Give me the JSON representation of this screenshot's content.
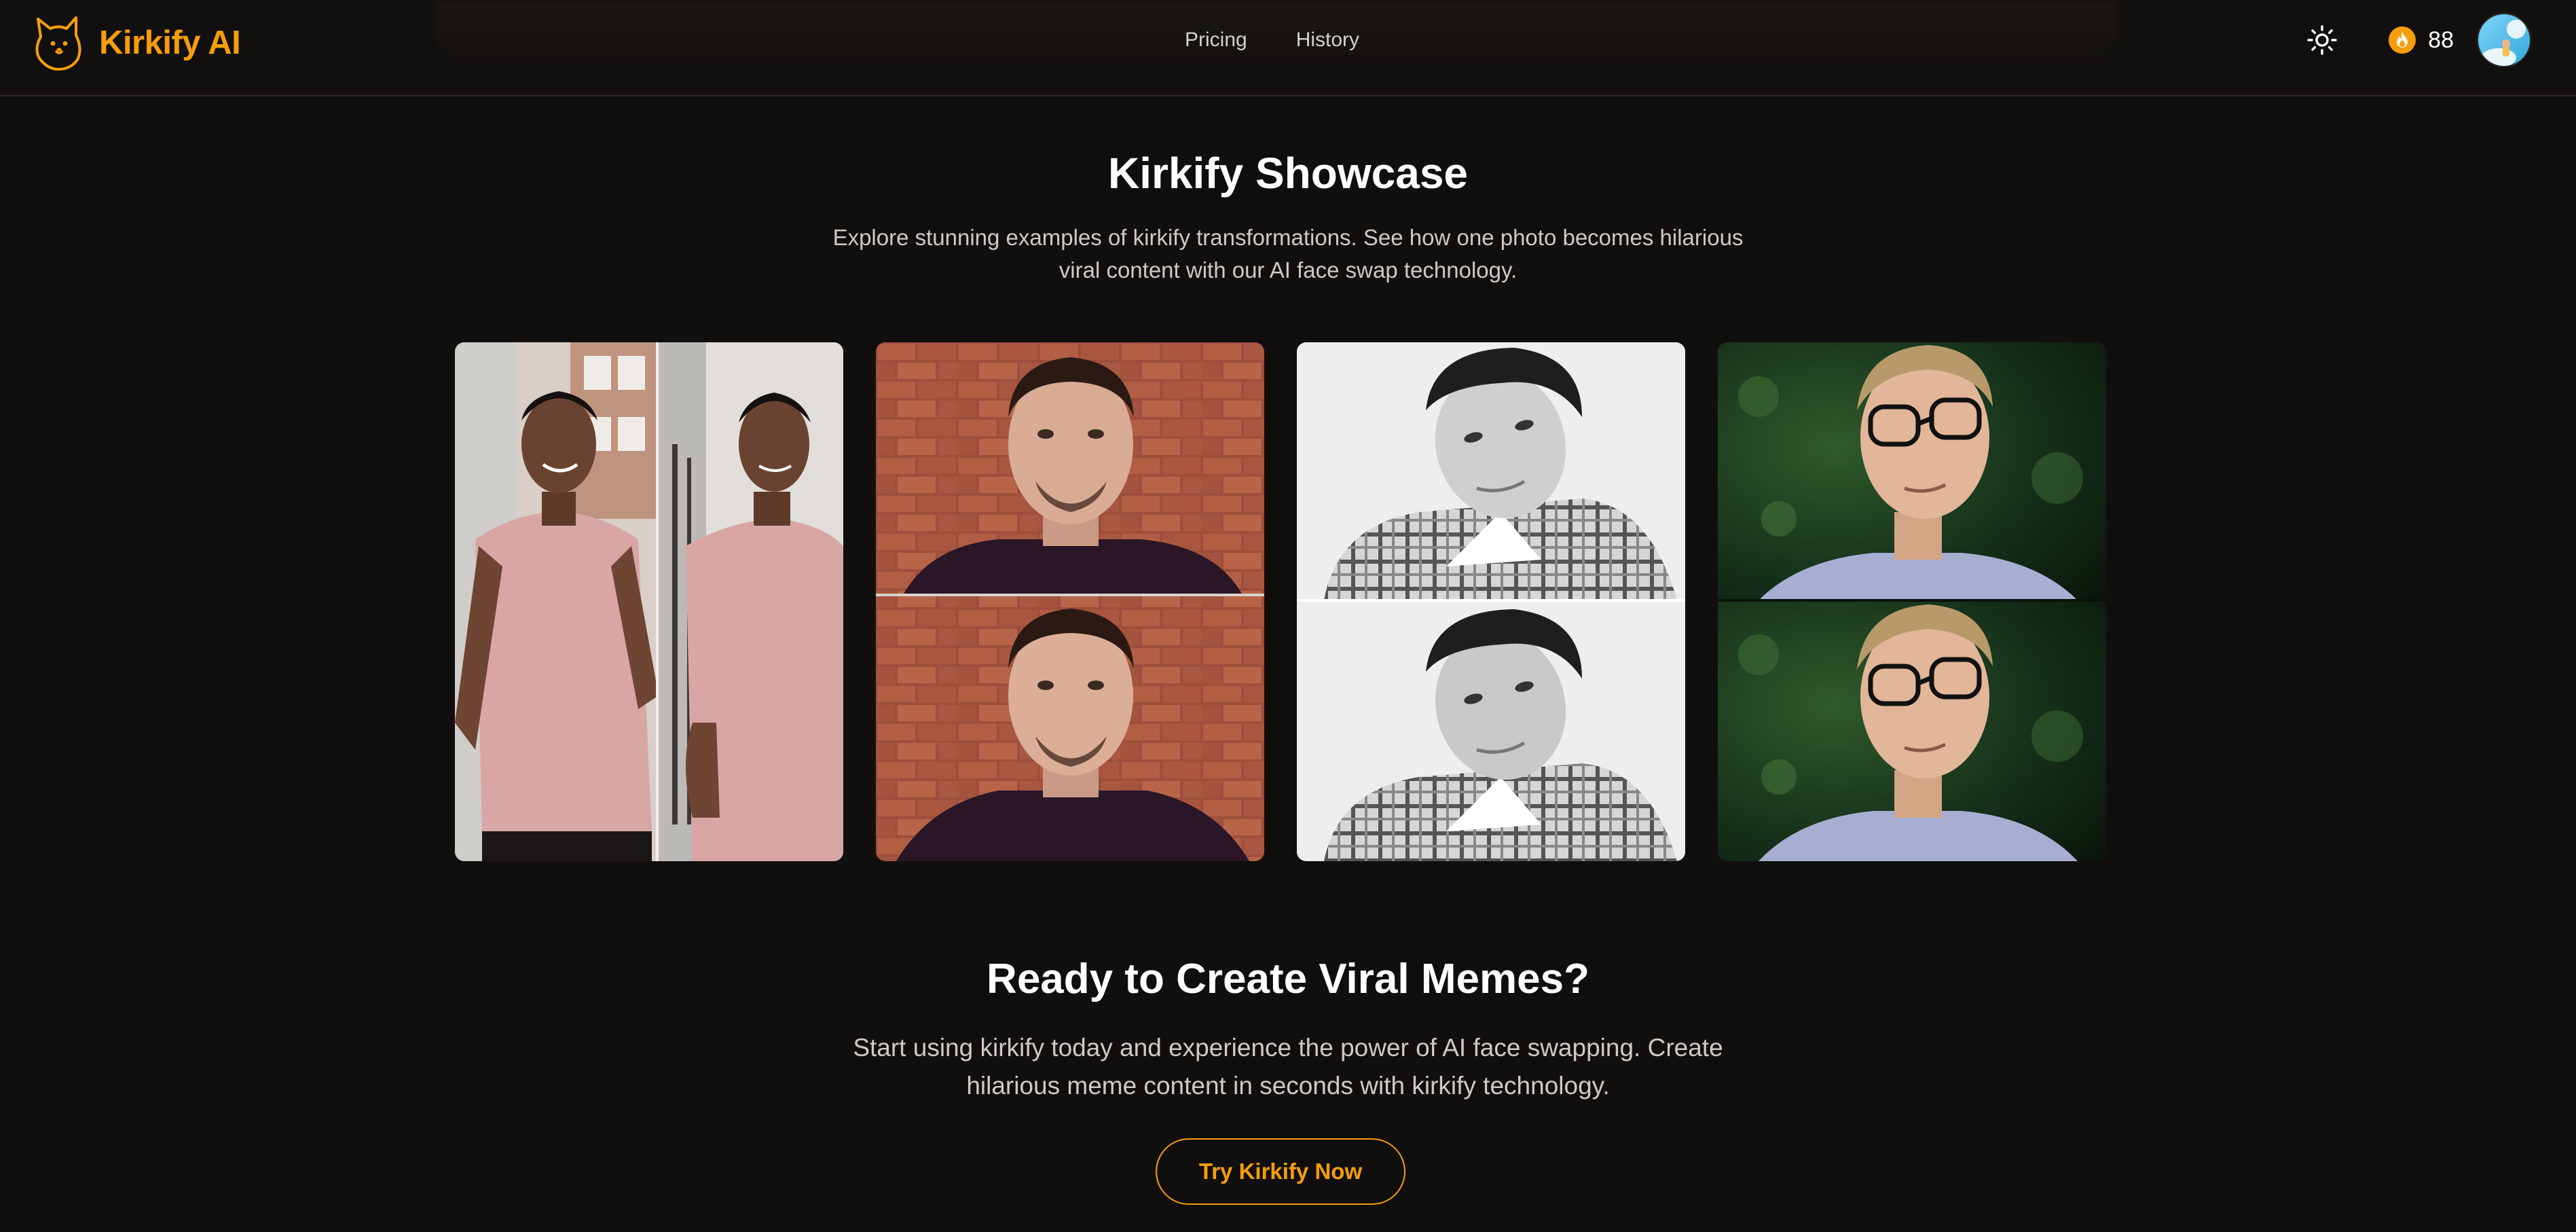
{
  "brand": {
    "name": "Kirkify AI",
    "accent_color": "#f59e0b"
  },
  "nav": {
    "items": [
      {
        "label": "Pricing"
      },
      {
        "label": "History"
      }
    ]
  },
  "header": {
    "theme_icon": "sun-icon",
    "credits_icon": "flame-coin-icon",
    "credits": "88",
    "avatar_icon": "user-avatar"
  },
  "showcase": {
    "title": "Kirkify Showcase",
    "description": "Explore stunning examples of kirkify transformations. See how one photo becomes hilarious viral content with our AI face swap technology."
  },
  "cta": {
    "title": "Ready to Create Viral Memes?",
    "description": "Start using kirkify today and experience the power of AI face swapping. Create hilarious meme content in seconds with kirkify technology.",
    "button_label": "Try Kirkify Now"
  },
  "colors": {
    "background": "#110f0d",
    "text": "#ffffff",
    "muted_text": "#cfcac4"
  }
}
